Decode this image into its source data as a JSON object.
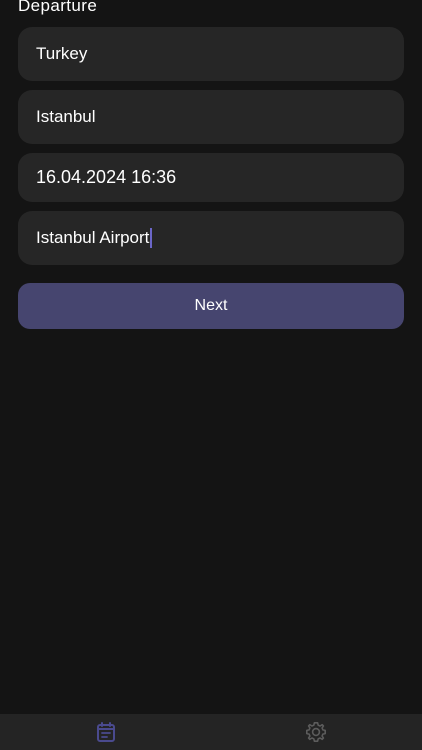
{
  "header": {
    "title": "Departure"
  },
  "form": {
    "country": "Turkey",
    "city": "Istanbul",
    "datetime": "16.04.2024 16:36",
    "airport": "Istanbul Airport"
  },
  "actions": {
    "next_label": "Next"
  },
  "tabbar": {
    "items": [
      {
        "icon": "calendar-icon",
        "active": true
      },
      {
        "icon": "gear-icon",
        "active": false
      }
    ]
  },
  "colors": {
    "background": "#141414",
    "field": "#262626",
    "accent": "#46456f",
    "active_icon": "#4a4a8e",
    "inactive_icon": "#5c5c5c"
  }
}
